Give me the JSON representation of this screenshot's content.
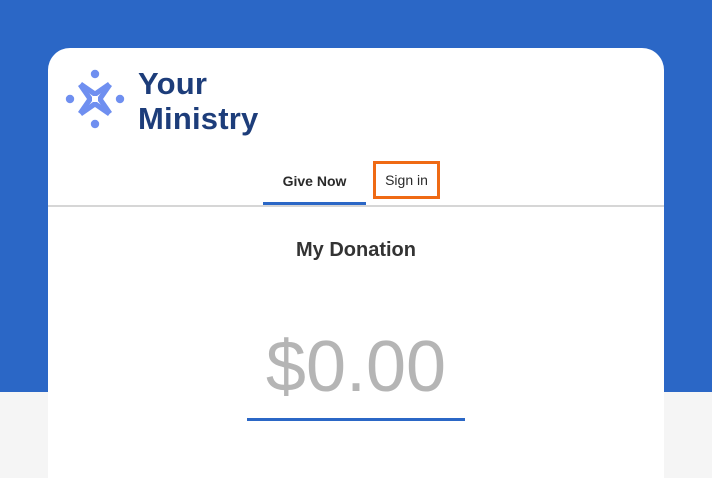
{
  "brand": {
    "line1": "Your",
    "line2": "Ministry",
    "logo_icon": "ministry-people-circle-logo",
    "text_color": "#1d3d7a",
    "mark_color": "#6f8ff0"
  },
  "tabs": [
    {
      "label": "Give Now",
      "active": true
    },
    {
      "label": "Sign in",
      "highlighted": true
    }
  ],
  "donation": {
    "title": "My Donation",
    "amount": "$0.00"
  },
  "colors": {
    "accent": "#2b67c6",
    "highlight": "#ef6a14",
    "amount_placeholder": "#b5b5b5"
  }
}
